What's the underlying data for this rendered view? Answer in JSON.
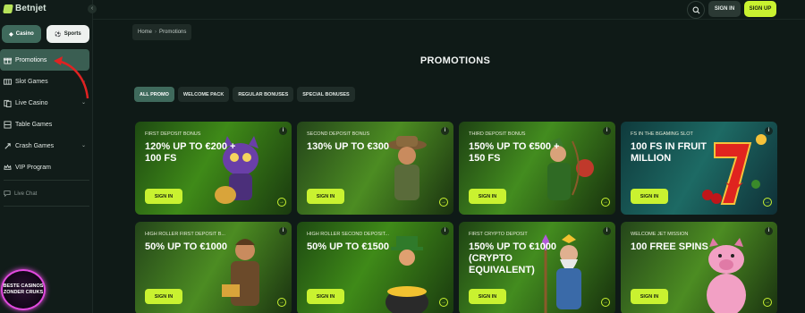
{
  "app": {
    "logo_text": "Betnjet"
  },
  "sidebar": {
    "collapse_icon": "‹",
    "tabs": [
      {
        "label": "Casino"
      },
      {
        "label": "Sports"
      }
    ],
    "items": [
      {
        "label": "Promotions",
        "icon": "gift-icon"
      },
      {
        "label": "Slot Games",
        "icon": "slot-icon"
      },
      {
        "label": "Live Casino",
        "icon": "cards-icon"
      },
      {
        "label": "Table Games",
        "icon": "table-icon"
      },
      {
        "label": "Crash Games",
        "icon": "rocket-icon"
      },
      {
        "label": "VIP Program",
        "icon": "crown-icon"
      }
    ],
    "live_chat": "Live Chat",
    "badge": {
      "line1": "BESTE CASINOS",
      "line2": "ZONDER CRUKS"
    }
  },
  "header": {
    "signin": "SIGN IN",
    "signup": "SIGN UP"
  },
  "breadcrumb": {
    "home": "Home",
    "current": "Promotions"
  },
  "page": {
    "title": "PROMOTIONS"
  },
  "filters": [
    "ALL PROMO",
    "WELCOME PACK",
    "REGULAR BONUSES",
    "SPECIAL BONUSES"
  ],
  "cards": [
    {
      "label": "FIRST DEPOSIT BONUS",
      "headline": "120% UP TO €200 + 100 FS",
      "button": "SIGN IN"
    },
    {
      "label": "SECOND DEPOSIT BONUS",
      "headline": "130% UP TO €300",
      "button": "SIGN IN"
    },
    {
      "label": "THIRD DEPOSIT BONUS",
      "headline": "150% UP TO €500 + 150 FS",
      "button": "SIGN IN"
    },
    {
      "label": "FS IN THE BGAMING SLOT",
      "headline": "100 FS IN FRUIT MILLION",
      "button": "SIGN IN"
    },
    {
      "label": "HIGH ROLLER FIRST DEPOSIT B...",
      "headline": "50% UP TO €1000",
      "button": "SIGN IN"
    },
    {
      "label": "HIGH ROLLER SECOND DEPOSIT...",
      "headline": "50% UP TO €1500",
      "button": "SIGN IN"
    },
    {
      "label": "FIRST CRYPTO DEPOSIT",
      "headline": "150% UP TO €1000 (CRYPTO EQUIVALENT)",
      "button": "SIGN IN"
    },
    {
      "label": "WELCOME JET MISSION",
      "headline": "100 FREE SPINS",
      "button": "SIGN IN"
    }
  ]
}
